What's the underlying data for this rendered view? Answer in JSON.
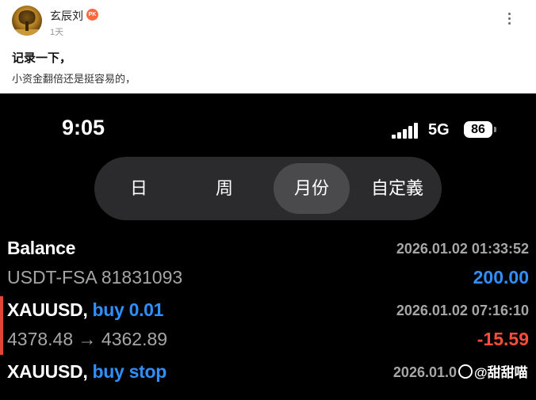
{
  "post": {
    "username": "玄辰刘",
    "badge": "PK",
    "time": "1天",
    "title": "记录一下，",
    "body": "小资金翻倍还是挺容易的，"
  },
  "phone": {
    "status_time": "9:05",
    "network": "5G",
    "battery": "86",
    "tabs": [
      {
        "label": "日",
        "active": false
      },
      {
        "label": "周",
        "active": false
      },
      {
        "label": "月份",
        "active": true
      },
      {
        "label": "自定義",
        "active": false
      }
    ],
    "rows": [
      {
        "symbol": "Balance",
        "direction": "",
        "datetime": "2026.01.02 01:33:52",
        "detail": "USDT-FSA 81831093",
        "amount": "200.00",
        "amount_color": "#2f8fff"
      },
      {
        "symbol": "XAUUSD, ",
        "direction": "buy 0.01",
        "datetime": "2026.01.02 07:16:10",
        "detail": "4378.48 → 4362.89",
        "amount": "-15.59",
        "amount_color": "#ff4d3a"
      },
      {
        "symbol": "XAUUSD, ",
        "direction": "buy stop",
        "datetime": "2026.01.0",
        "detail": "",
        "amount": "",
        "amount_color": "#a6a6a6"
      }
    ],
    "watermark": "@甜甜喵"
  },
  "colors": {
    "accent_blue": "#2f8fff",
    "loss_red": "#ff4d3a",
    "segment_bg": "#2b2b2d",
    "segment_active": "#4a4a4d"
  }
}
